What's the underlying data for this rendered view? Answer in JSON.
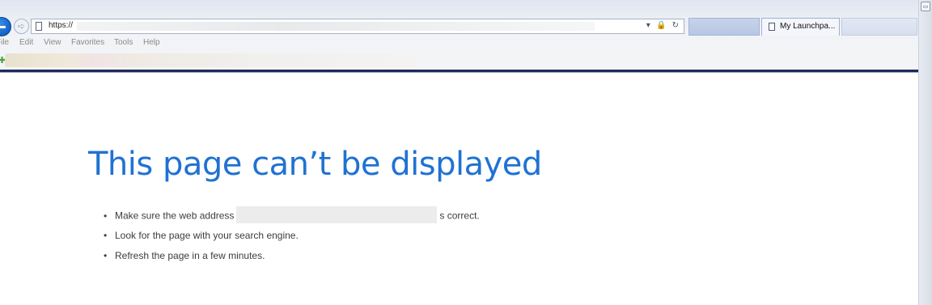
{
  "browser": {
    "address": {
      "url_prefix": "https://",
      "controls": "▾ 🔒 ↻"
    },
    "tabs": [
      {
        "label": ""
      },
      {
        "label": "My Launchpa..."
      },
      {
        "label": ""
      }
    ],
    "menu": [
      "File",
      "Edit",
      "View",
      "Favorites",
      "Tools",
      "Help"
    ]
  },
  "page": {
    "title": "This page can’t be displayed",
    "tips": [
      {
        "before": "Make sure the web address",
        "after": "s correct."
      },
      {
        "text": "Look for the page with your search engine."
      },
      {
        "text": "Refresh the page in a few minutes."
      }
    ]
  },
  "colors": {
    "title": "#2072d2",
    "divider": "#1f2a5a"
  }
}
